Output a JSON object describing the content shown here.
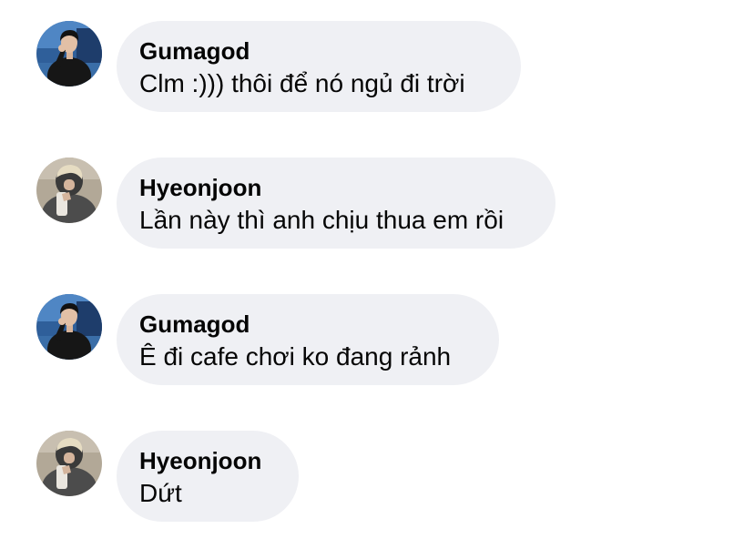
{
  "comments": [
    {
      "author": "Gumagod",
      "text": "Clm :))) thôi để nó ngủ đi trời",
      "avatar_icon": "profile-photo-gumagod"
    },
    {
      "author": "Hyeonjoon",
      "text": "Lần này thì anh chịu thua em rồi",
      "avatar_icon": "profile-photo-hyeonjoon"
    },
    {
      "author": "Gumagod",
      "text": "Ê đi cafe chơi ko đang rảnh",
      "avatar_icon": "profile-photo-gumagod"
    },
    {
      "author": "Hyeonjoon",
      "text": "Dứt",
      "avatar_icon": "profile-photo-hyeonjoon"
    }
  ],
  "colors": {
    "bubble_background": "#eff0f4",
    "text": "#050505",
    "page_background": "#ffffff"
  }
}
